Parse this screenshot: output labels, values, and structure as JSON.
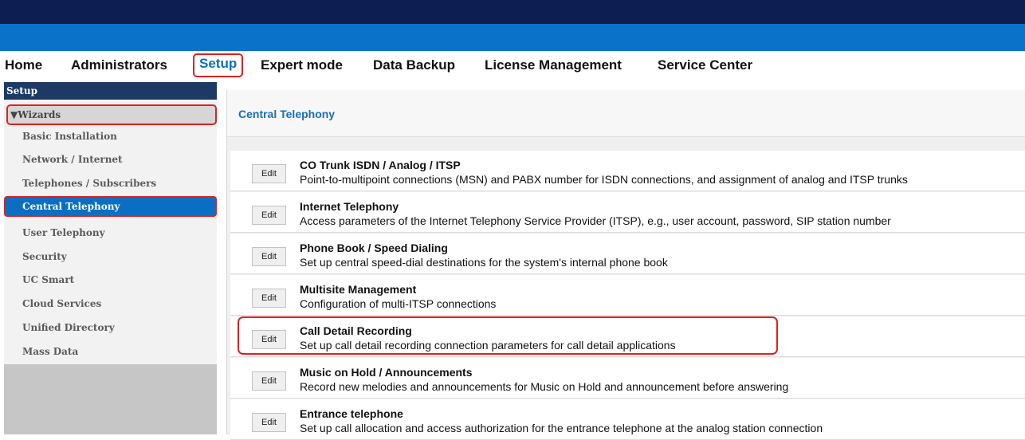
{
  "nav": {
    "items": [
      "Home",
      "Administrators",
      "Setup",
      "Expert mode",
      "Data Backup",
      "License Management",
      "Service Center"
    ]
  },
  "sidebar": {
    "title": "Setup",
    "section": "Wizards",
    "items": [
      {
        "label": "Basic Installation"
      },
      {
        "label": "Network / Internet"
      },
      {
        "label": "Telephones / Subscribers"
      },
      {
        "label": "Central Telephony"
      },
      {
        "label": "User Telephony"
      },
      {
        "label": "Security"
      },
      {
        "label": "UC Smart"
      },
      {
        "label": "Cloud Services"
      },
      {
        "label": "Unified Directory"
      },
      {
        "label": "Mass Data"
      }
    ]
  },
  "panel": {
    "title": "Central Telephony",
    "edit_label": "Edit",
    "rows": [
      {
        "title": "CO Trunk ISDN / Analog / ITSP",
        "desc": "Point-to-multipoint connections (MSN) and PABX number for ISDN connections, and assignment of analog and ITSP trunks"
      },
      {
        "title": "Internet Telephony",
        "desc": "Access parameters of the Internet Telephony Service Provider (ITSP), e.g., user account, password, SIP station number"
      },
      {
        "title": "Phone Book / Speed Dialing",
        "desc": "Set up central speed-dial destinations for the system's internal phone book"
      },
      {
        "title": "Multisite Management",
        "desc": "Configuration of multi-ITSP connections"
      },
      {
        "title": "Call Detail Recording",
        "desc": "Set up call detail recording connection parameters for call detail applications"
      },
      {
        "title": "Music on Hold / Announcements",
        "desc": "Record new melodies and announcements for Music on Hold and announcement before answering"
      },
      {
        "title": "Entrance telephone",
        "desc": "Set up call allocation and access authorization for the entrance telephone at the analog station connection"
      }
    ]
  },
  "colors": {
    "top_bar": "#0c1e52",
    "blue_bar": "#0a73c9",
    "accent": "#0a6fc2",
    "highlight": "#e02020"
  }
}
